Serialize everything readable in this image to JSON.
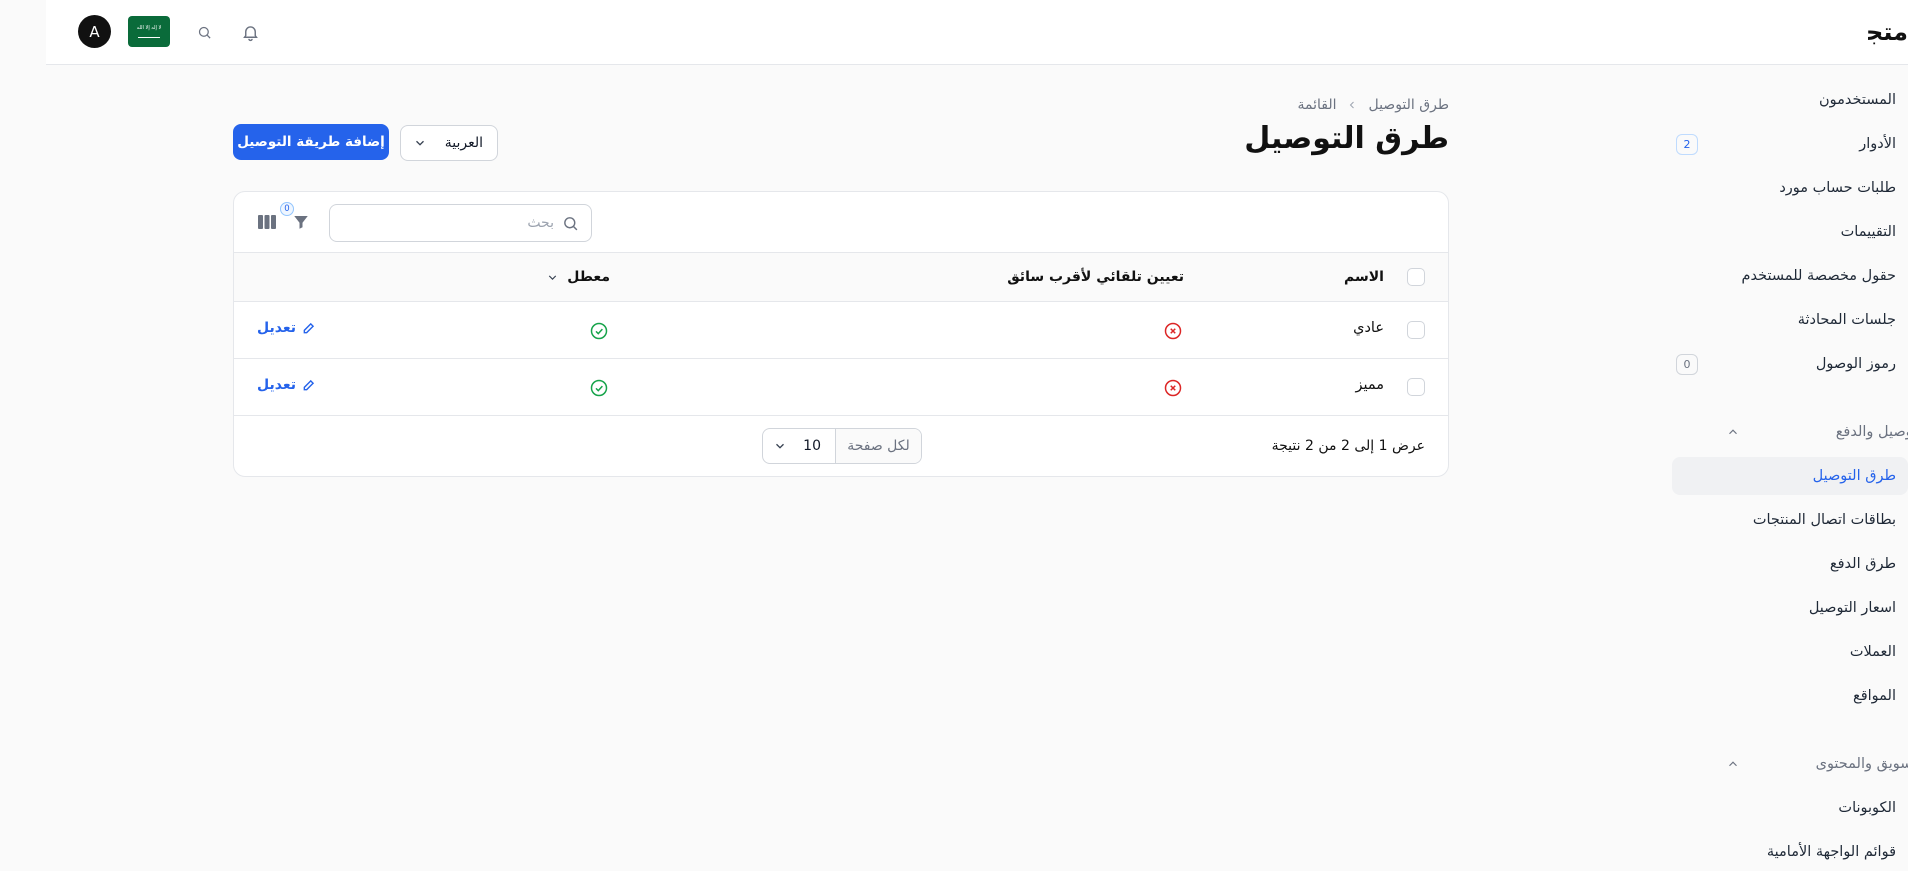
{
  "topbar": {
    "brand": "متجري",
    "avatar_letter": "A",
    "flag_text": "لا إله إلا الله"
  },
  "sidebar": {
    "items": [
      {
        "label": "المستخدمون"
      },
      {
        "label": "الأدوار",
        "badge": "2"
      },
      {
        "label": "طلبات حساب مورد"
      },
      {
        "label": "التقييمات"
      },
      {
        "label": "حقول مخصصة للمستخدم"
      },
      {
        "label": "جلسات المحادثة"
      },
      {
        "label": "رموز الوصول",
        "badge": "0"
      }
    ],
    "group1": "التوصيل والدفع",
    "group1_items": [
      {
        "label": "طرق التوصيل",
        "active": true
      },
      {
        "label": "بطاقات اتصال المنتجات"
      },
      {
        "label": "طرق الدفع"
      },
      {
        "label": "اسعار التوصيل"
      },
      {
        "label": "العملات"
      },
      {
        "label": "المواقع"
      }
    ],
    "group2": "التسويق والمحتوى",
    "group2_items": [
      {
        "label": "الكوبونات"
      },
      {
        "label": "قوائم الواجهة الأمامية"
      }
    ]
  },
  "breadcrumb": {
    "items": [
      "طرق التوصيل",
      "القائمة"
    ]
  },
  "page": {
    "title": "طرق التوصيل",
    "language": "العربية",
    "add_button": "إضافة طريقة التوصيل"
  },
  "table": {
    "search_placeholder": "بحث",
    "filter_count": "0",
    "columns": {
      "name": "الاسم",
      "auto_assign": "تعيين تلقائي لأقرب سائق",
      "disabled": "معطل"
    },
    "rows": [
      {
        "name": "عادي",
        "auto_assign": false,
        "disabled": true,
        "action": "تعديل"
      },
      {
        "name": "مميز",
        "auto_assign": false,
        "disabled": true,
        "action": "تعديل"
      }
    ],
    "summary": "عرض 1 إلى 2 من 2 نتيجة",
    "per_page_label": "لكل صفحة",
    "per_page_value": "10"
  },
  "colors": {
    "accent": "#2563eb",
    "success": "#16a34a",
    "danger": "#dc2626"
  }
}
